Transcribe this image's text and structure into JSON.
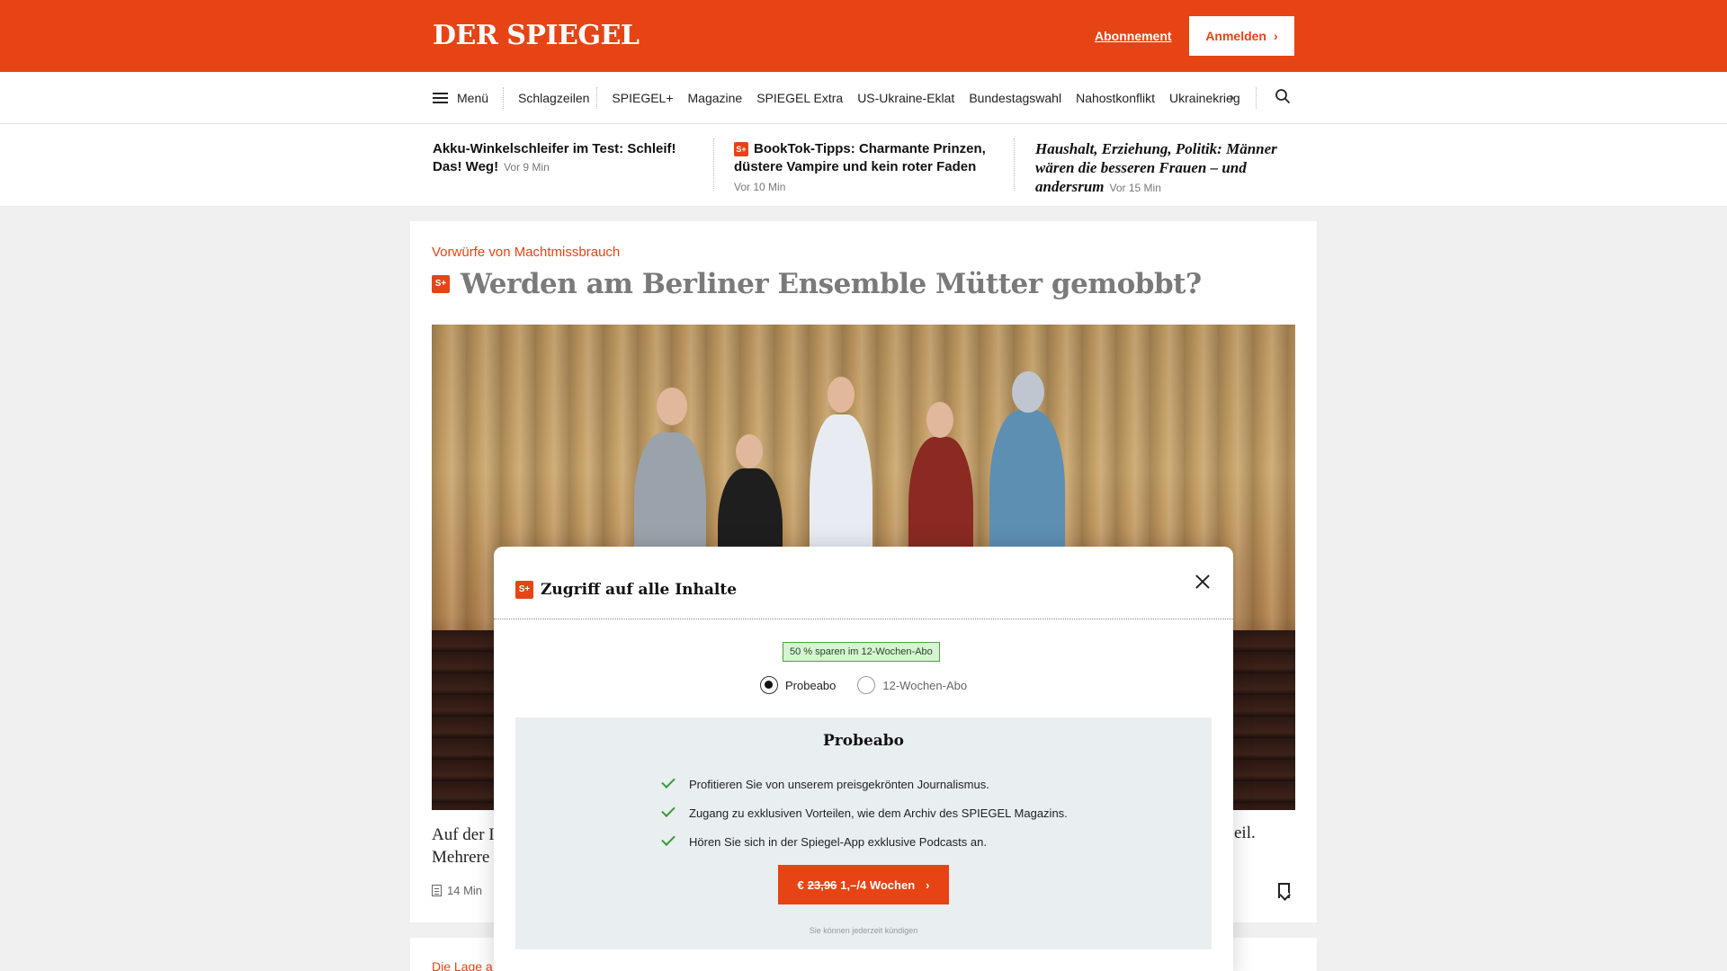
{
  "header": {
    "logo": "DER SPIEGEL",
    "subscription_link": "Abonnement",
    "login_button": "Anmelden",
    "accent_color": "#e64415"
  },
  "nav": {
    "menu_label": "Menü",
    "items": [
      "Schlagzeilen",
      "SPIEGEL+",
      "Magazine",
      "SPIEGEL Extra",
      "US-Ukraine-Eklat",
      "Bundestagswahl",
      "Nahostkonflikt",
      "Ukrainekrieg"
    ],
    "next_icon": "chevron-right-icon",
    "search_icon": "search-icon"
  },
  "teasers": [
    {
      "title": "Akku-Winkelschleifer im Test: Schleif! Das! Weg!",
      "time": "Vor 9 Min",
      "plus": false
    },
    {
      "title": "BookTok-Tipps: Charmante Prinzen, düstere Vampire und kein roter Faden",
      "time": "Vor 10 Min",
      "plus": true,
      "plus_label": "S+"
    },
    {
      "title": "Haushalt, Erziehung, Politik: Männer wären die besseren Frauen – und andersrum",
      "time": "Vor 15 Min",
      "plus": false
    }
  ],
  "article": {
    "kicker": "Vorwürfe von Machtmissbrauch",
    "plus_label": "S+",
    "headline": "Werden am Berliner Ensemble Mütter gemobbt?",
    "teaser_left_line1": "Auf der I",
    "teaser_left_line2": "Mehrere",
    "teaser_right": "eil.",
    "read_time": "14 Min",
    "bookmark_icon": "bookmark-icon"
  },
  "next_card": {
    "kicker": "Die Lage a"
  },
  "modal": {
    "plus_label": "S+",
    "title": "Zugriff auf alle Inhalte",
    "close_icon": "close-icon",
    "save_badge": "50 % sparen im 12-Wochen-Abo",
    "options": [
      {
        "label": "Probeabo",
        "selected": true
      },
      {
        "label": "12-Wochen-Abo",
        "selected": false
      }
    ],
    "plan": {
      "title": "Probeabo",
      "features": [
        "Profitieren Sie von unserem preisgekrönten Journalismus.",
        "Zugang zu exklusiven Vorteilen, wie dem Archiv des SPIEGEL Magazins.",
        "Hören Sie sich in der Spiegel-App exklusive Podcasts an."
      ],
      "cta_prefix": "€",
      "cta_old_price": "23,96",
      "cta_price": "1,–/4 Wochen",
      "cancel_note": "Sie können jederzeit kündigen"
    }
  }
}
